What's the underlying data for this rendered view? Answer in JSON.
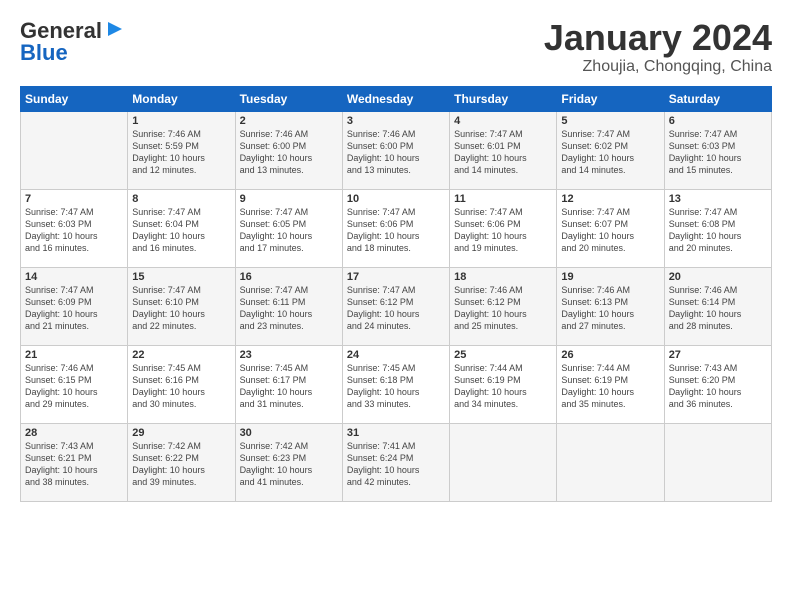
{
  "logo": {
    "line1": "General",
    "line2": "Blue"
  },
  "title": "January 2024",
  "subtitle": "Zhoujia, Chongqing, China",
  "days_header": [
    "Sunday",
    "Monday",
    "Tuesday",
    "Wednesday",
    "Thursday",
    "Friday",
    "Saturday"
  ],
  "weeks": [
    [
      {
        "day": "",
        "info": ""
      },
      {
        "day": "1",
        "info": "Sunrise: 7:46 AM\nSunset: 5:59 PM\nDaylight: 10 hours\nand 12 minutes."
      },
      {
        "day": "2",
        "info": "Sunrise: 7:46 AM\nSunset: 6:00 PM\nDaylight: 10 hours\nand 13 minutes."
      },
      {
        "day": "3",
        "info": "Sunrise: 7:46 AM\nSunset: 6:00 PM\nDaylight: 10 hours\nand 13 minutes."
      },
      {
        "day": "4",
        "info": "Sunrise: 7:47 AM\nSunset: 6:01 PM\nDaylight: 10 hours\nand 14 minutes."
      },
      {
        "day": "5",
        "info": "Sunrise: 7:47 AM\nSunset: 6:02 PM\nDaylight: 10 hours\nand 14 minutes."
      },
      {
        "day": "6",
        "info": "Sunrise: 7:47 AM\nSunset: 6:03 PM\nDaylight: 10 hours\nand 15 minutes."
      }
    ],
    [
      {
        "day": "7",
        "info": "Sunrise: 7:47 AM\nSunset: 6:03 PM\nDaylight: 10 hours\nand 16 minutes."
      },
      {
        "day": "8",
        "info": "Sunrise: 7:47 AM\nSunset: 6:04 PM\nDaylight: 10 hours\nand 16 minutes."
      },
      {
        "day": "9",
        "info": "Sunrise: 7:47 AM\nSunset: 6:05 PM\nDaylight: 10 hours\nand 17 minutes."
      },
      {
        "day": "10",
        "info": "Sunrise: 7:47 AM\nSunset: 6:06 PM\nDaylight: 10 hours\nand 18 minutes."
      },
      {
        "day": "11",
        "info": "Sunrise: 7:47 AM\nSunset: 6:06 PM\nDaylight: 10 hours\nand 19 minutes."
      },
      {
        "day": "12",
        "info": "Sunrise: 7:47 AM\nSunset: 6:07 PM\nDaylight: 10 hours\nand 20 minutes."
      },
      {
        "day": "13",
        "info": "Sunrise: 7:47 AM\nSunset: 6:08 PM\nDaylight: 10 hours\nand 20 minutes."
      }
    ],
    [
      {
        "day": "14",
        "info": "Sunrise: 7:47 AM\nSunset: 6:09 PM\nDaylight: 10 hours\nand 21 minutes."
      },
      {
        "day": "15",
        "info": "Sunrise: 7:47 AM\nSunset: 6:10 PM\nDaylight: 10 hours\nand 22 minutes."
      },
      {
        "day": "16",
        "info": "Sunrise: 7:47 AM\nSunset: 6:11 PM\nDaylight: 10 hours\nand 23 minutes."
      },
      {
        "day": "17",
        "info": "Sunrise: 7:47 AM\nSunset: 6:12 PM\nDaylight: 10 hours\nand 24 minutes."
      },
      {
        "day": "18",
        "info": "Sunrise: 7:46 AM\nSunset: 6:12 PM\nDaylight: 10 hours\nand 25 minutes."
      },
      {
        "day": "19",
        "info": "Sunrise: 7:46 AM\nSunset: 6:13 PM\nDaylight: 10 hours\nand 27 minutes."
      },
      {
        "day": "20",
        "info": "Sunrise: 7:46 AM\nSunset: 6:14 PM\nDaylight: 10 hours\nand 28 minutes."
      }
    ],
    [
      {
        "day": "21",
        "info": "Sunrise: 7:46 AM\nSunset: 6:15 PM\nDaylight: 10 hours\nand 29 minutes."
      },
      {
        "day": "22",
        "info": "Sunrise: 7:45 AM\nSunset: 6:16 PM\nDaylight: 10 hours\nand 30 minutes."
      },
      {
        "day": "23",
        "info": "Sunrise: 7:45 AM\nSunset: 6:17 PM\nDaylight: 10 hours\nand 31 minutes."
      },
      {
        "day": "24",
        "info": "Sunrise: 7:45 AM\nSunset: 6:18 PM\nDaylight: 10 hours\nand 33 minutes."
      },
      {
        "day": "25",
        "info": "Sunrise: 7:44 AM\nSunset: 6:19 PM\nDaylight: 10 hours\nand 34 minutes."
      },
      {
        "day": "26",
        "info": "Sunrise: 7:44 AM\nSunset: 6:19 PM\nDaylight: 10 hours\nand 35 minutes."
      },
      {
        "day": "27",
        "info": "Sunrise: 7:43 AM\nSunset: 6:20 PM\nDaylight: 10 hours\nand 36 minutes."
      }
    ],
    [
      {
        "day": "28",
        "info": "Sunrise: 7:43 AM\nSunset: 6:21 PM\nDaylight: 10 hours\nand 38 minutes."
      },
      {
        "day": "29",
        "info": "Sunrise: 7:42 AM\nSunset: 6:22 PM\nDaylight: 10 hours\nand 39 minutes."
      },
      {
        "day": "30",
        "info": "Sunrise: 7:42 AM\nSunset: 6:23 PM\nDaylight: 10 hours\nand 41 minutes."
      },
      {
        "day": "31",
        "info": "Sunrise: 7:41 AM\nSunset: 6:24 PM\nDaylight: 10 hours\nand 42 minutes."
      },
      {
        "day": "",
        "info": ""
      },
      {
        "day": "",
        "info": ""
      },
      {
        "day": "",
        "info": ""
      }
    ]
  ]
}
